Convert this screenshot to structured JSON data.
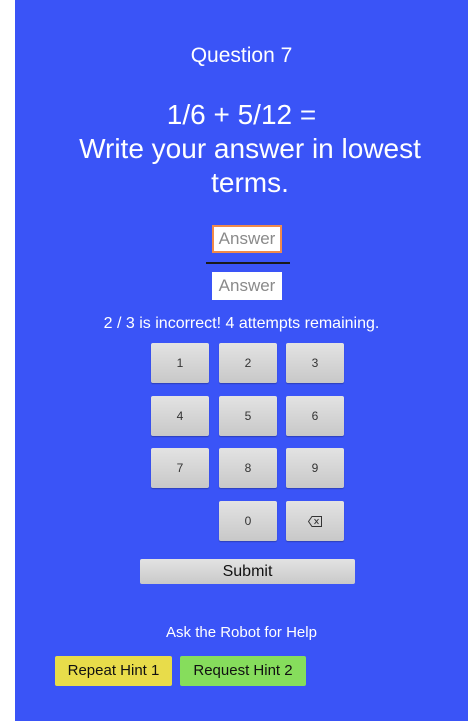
{
  "question": {
    "label": "Question  7",
    "problem": "1/6 + 5/12 =",
    "instruction": "Write your answer in lowest terms."
  },
  "answer": {
    "numerator_placeholder": "Answer",
    "denominator_placeholder": "Answer"
  },
  "feedback": "2 / 3 is incorrect! 4 attempts remaining.",
  "keypad": {
    "keys": [
      "1",
      "2",
      "3",
      "4",
      "5",
      "6",
      "7",
      "8",
      "9",
      "0"
    ],
    "backspace_icon": "backspace-icon"
  },
  "submit_label": "Submit",
  "help": {
    "label": "Ask the Robot for Help",
    "repeat_hint_label": "Repeat Hint 1",
    "request_hint_label": "Request Hint 2"
  },
  "colors": {
    "background": "#3a54f7",
    "repeat_hint": "#e8dc4a",
    "request_hint": "#86dd5c",
    "answer_focus_border": "#f08a4b"
  }
}
